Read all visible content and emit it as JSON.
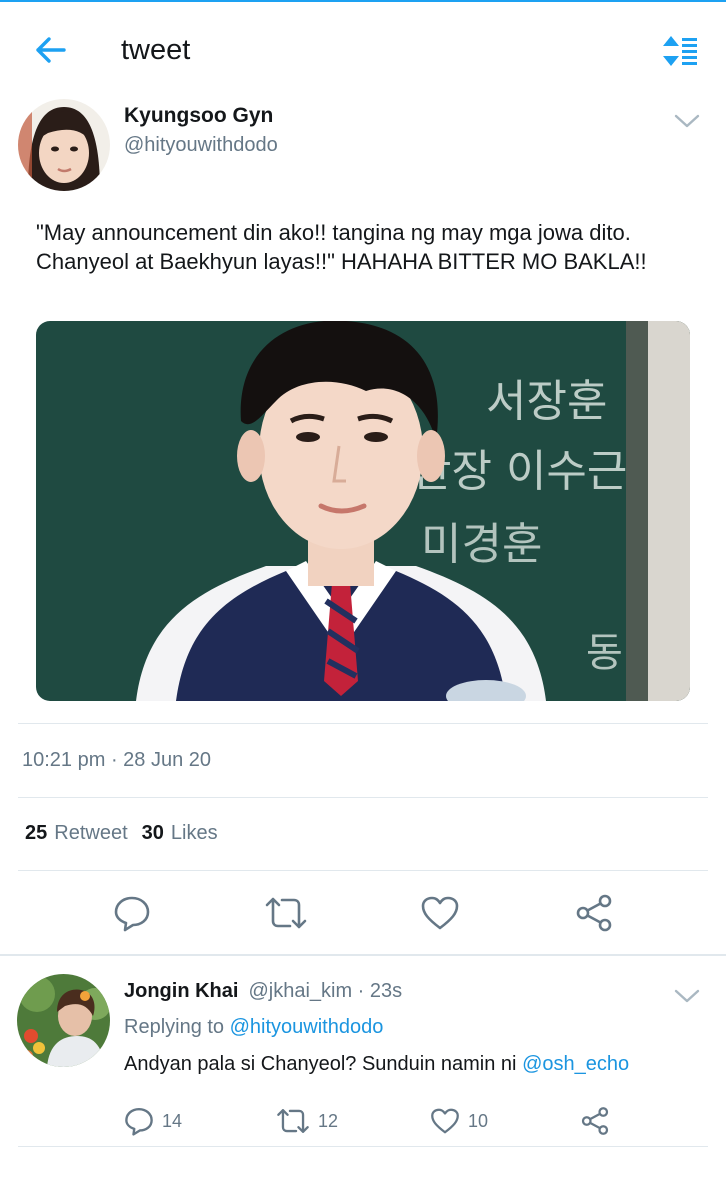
{
  "header": {
    "title": "tweet",
    "back_icon": "arrow-left-icon",
    "sort_icon": "sort-list-icon",
    "accent": "#1da1f2"
  },
  "tweet": {
    "author_name": "Kyungsoo Gyn",
    "author_handle": "@hityouwithdodo",
    "text": "\"May announcement din ako!! tangina ng may mga jowa dito. Chanyeol at Baekhyun layas!!\" HAHAHA BITTER MO BAKLA!!",
    "media": {
      "chalkboard_lines": [
        "서장훈",
        "반장 이수근",
        "미경훈",
        "동"
      ]
    },
    "timestamp": "10:21 pm · 28 Jun 20",
    "stats": {
      "retweets_count": "25",
      "retweets_label": "Retweet",
      "likes_count": "30",
      "likes_label": "Likes"
    }
  },
  "reply": {
    "author_name": "Jongin Khai",
    "meta": "@jkhai_kim · 23s",
    "replying_prefix": "Replying to",
    "replying_to": "@hityouwithdodo",
    "text": "Andyan pala si Chanyeol? Sunduin namin ni",
    "mention": "@osh_echo",
    "reply_count": "14",
    "retweet_count": "12",
    "like_count": "10"
  },
  "colors": {
    "text": "#14171a",
    "muted": "#657786",
    "link": "#1b95e0",
    "divider": "#e1e8ed"
  }
}
